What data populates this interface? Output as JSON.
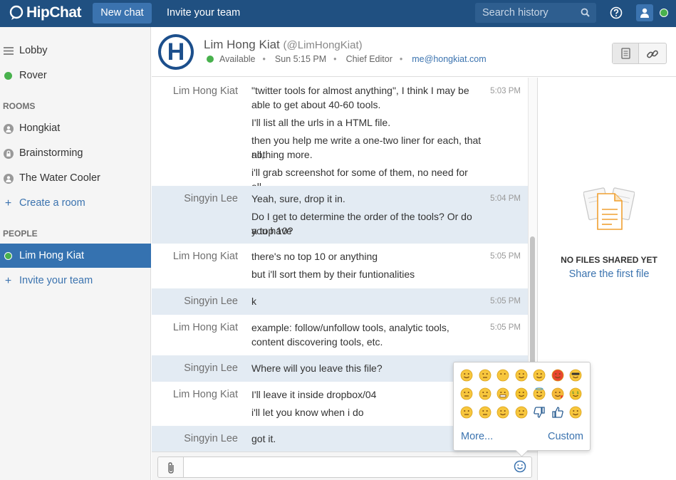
{
  "topbar": {
    "logo_text": "HipChat",
    "new_chat_label": "New chat",
    "invite_label": "Invite your team",
    "search_placeholder": "Search history"
  },
  "sidebar": {
    "lobby": "Lobby",
    "rover": "Rover",
    "rooms_heading": "ROOMS",
    "rooms": [
      "Hongkiat",
      "Brainstorming",
      "The Water Cooler"
    ],
    "create_room": "Create a room",
    "people_heading": "PEOPLE",
    "people": [
      "Lim Hong Kiat"
    ],
    "invite_team": "Invite your team"
  },
  "header": {
    "avatar_letter": "H",
    "name": "Lim Hong Kiat",
    "handle": "(@LimHongKiat)",
    "status": "Available",
    "time": "Sun 5:15 PM",
    "title": "Chief Editor",
    "email": "me@hongkiat.com"
  },
  "messages": [
    {
      "from": "Lim Hong Kiat",
      "time": "5:03 PM",
      "lines": [
        "\"twitter tools for almost anything\", I think I may be",
        "able to get about 40-60 tools.",
        "I'll list all the urls in a HTML file.",
        "then you help me write a one-two liner for each, that all,",
        "nothing more.",
        "i'll grab screenshot for some of them, no need for all."
      ]
    },
    {
      "from": "Singyin Lee",
      "time": "5:04 PM",
      "lines": [
        "Yeah, sure, drop it in.",
        "Do I get to determine the order of the tools? Or do you have",
        "a top 10?"
      ]
    },
    {
      "from": "Lim Hong Kiat",
      "time": "5:05 PM",
      "lines": [
        "there's no top 10 or anything",
        "but i'll sort them by their funtionalities"
      ]
    },
    {
      "from": "Singyin Lee",
      "time": "5:05 PM",
      "lines": [
        "k"
      ]
    },
    {
      "from": "Lim Hong Kiat",
      "time": "5:05 PM",
      "lines": [
        "example: follow/unfollow tools, analytic tools,",
        "content discovering tools, etc."
      ]
    },
    {
      "from": "Singyin Lee",
      "time": "",
      "lines": [
        "Where will you leave this file?"
      ]
    },
    {
      "from": "Lim Hong Kiat",
      "time": "",
      "lines": [
        "I'll leave it inside dropbox/04",
        "i'll let you know when i do"
      ]
    },
    {
      "from": "Singyin Lee",
      "time": "",
      "lines": [
        "got it."
      ]
    }
  ],
  "files": {
    "empty_text": "NO FILES SHARED YET",
    "share_link": "Share the first file"
  },
  "emoji_popup": {
    "more_label": "More...",
    "custom_label": "Custom",
    "emojis": [
      "grin",
      "persevere",
      "no-mouth",
      "tongue",
      "dizzy",
      "rage",
      "sunglasses",
      "cry",
      "confused",
      "grimace",
      "flushed",
      "innocent",
      "kiss",
      "money",
      "cold-sweat",
      "unamused",
      "smile",
      "neutral",
      "thumbs-down",
      "thumbs-up",
      "blush"
    ]
  },
  "colors": {
    "topbar": "#205081",
    "accent": "#3b73af",
    "active_item": "#3572b0",
    "alt_row": "#e3ebf3",
    "online": "#48b14d"
  }
}
